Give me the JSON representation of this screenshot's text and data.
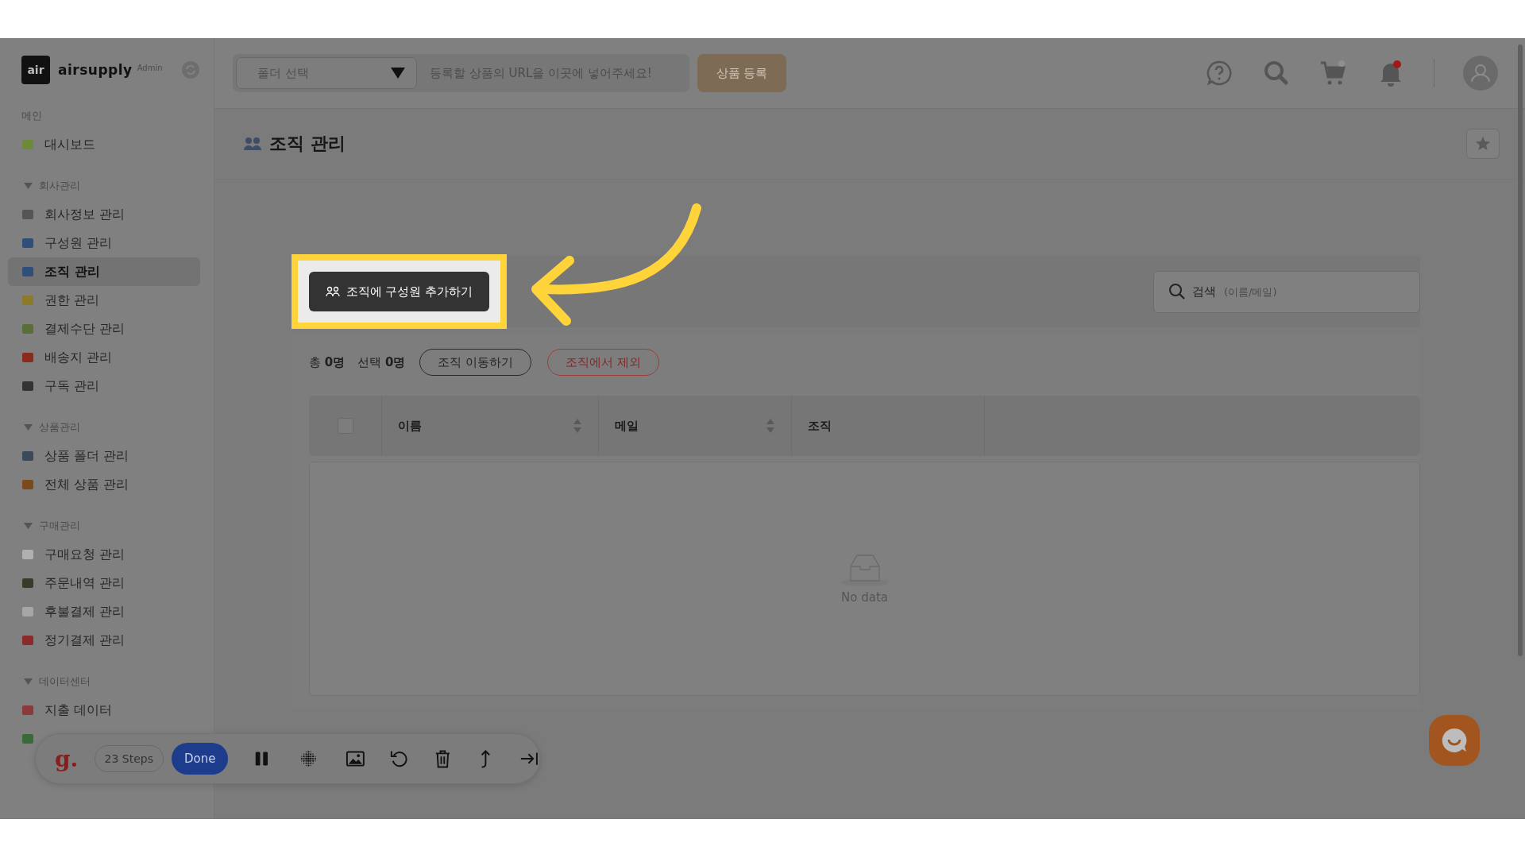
{
  "brand": {
    "logo_mark": "air",
    "name": "airsupply",
    "badge": "Admin"
  },
  "sidebar": {
    "sections": [
      {
        "label": "메인",
        "kind": "plain",
        "items": [
          {
            "label": "대시보드",
            "selected": false
          }
        ]
      },
      {
        "label": "회사관리",
        "kind": "group",
        "expanded": true,
        "items": [
          {
            "label": "회사정보 관리",
            "selected": false
          },
          {
            "label": "구성원 관리",
            "selected": false
          },
          {
            "label": "조직 관리",
            "selected": true
          },
          {
            "label": "권한 관리",
            "selected": false
          },
          {
            "label": "결제수단 관리",
            "selected": false
          },
          {
            "label": "배송지 관리",
            "selected": false
          },
          {
            "label": "구독 관리",
            "selected": false
          }
        ]
      },
      {
        "label": "상품관리",
        "kind": "group",
        "expanded": true,
        "items": [
          {
            "label": "상품 폴더 관리",
            "selected": false
          },
          {
            "label": "전체 상품 관리",
            "selected": false
          }
        ]
      },
      {
        "label": "구매관리",
        "kind": "group",
        "expanded": true,
        "items": [
          {
            "label": "구매요청 관리",
            "selected": false
          },
          {
            "label": "주문내역 관리",
            "selected": false
          },
          {
            "label": "후불결제 관리",
            "selected": false
          },
          {
            "label": "정기결제 관리",
            "selected": false
          }
        ]
      },
      {
        "label": "데이터센터",
        "kind": "group",
        "expanded": true,
        "items": [
          {
            "label": "지출 데이터",
            "selected": false
          },
          {
            "selected": false
          }
        ]
      }
    ]
  },
  "topbar": {
    "folder_select": {
      "placeholder": "폴더 선택"
    },
    "url_field": {
      "placeholder": "등록할 상품의 URL을 이곳에 넣어주세요!"
    },
    "register_button": {
      "label": "상품 등록",
      "disabled": true
    },
    "bell": {
      "unread": true
    }
  },
  "page": {
    "title": "조직 관리"
  },
  "toolbar": {
    "add_button": "조직에 구성원 추가하기",
    "search": {
      "label": "검색",
      "placeholder": "(이름/메일)"
    }
  },
  "summary": {
    "total": "총 **0명**",
    "selected": "선택 **0명**"
  },
  "actions": [
    {
      "label": "조직 이동하기",
      "kind": "default"
    },
    {
      "label": "조직에서 제외",
      "kind": "danger"
    }
  ],
  "table": {
    "select_all": {
      "checked": false
    },
    "columns": [
      {
        "label": "이름",
        "sortable": true
      },
      {
        "label": "메일",
        "sortable": true
      },
      {
        "label": "조직",
        "sortable": false
      }
    ],
    "empty_text": "No data"
  },
  "recorder": {
    "logo": "g.",
    "steps": "23 Steps",
    "done": "Done"
  }
}
